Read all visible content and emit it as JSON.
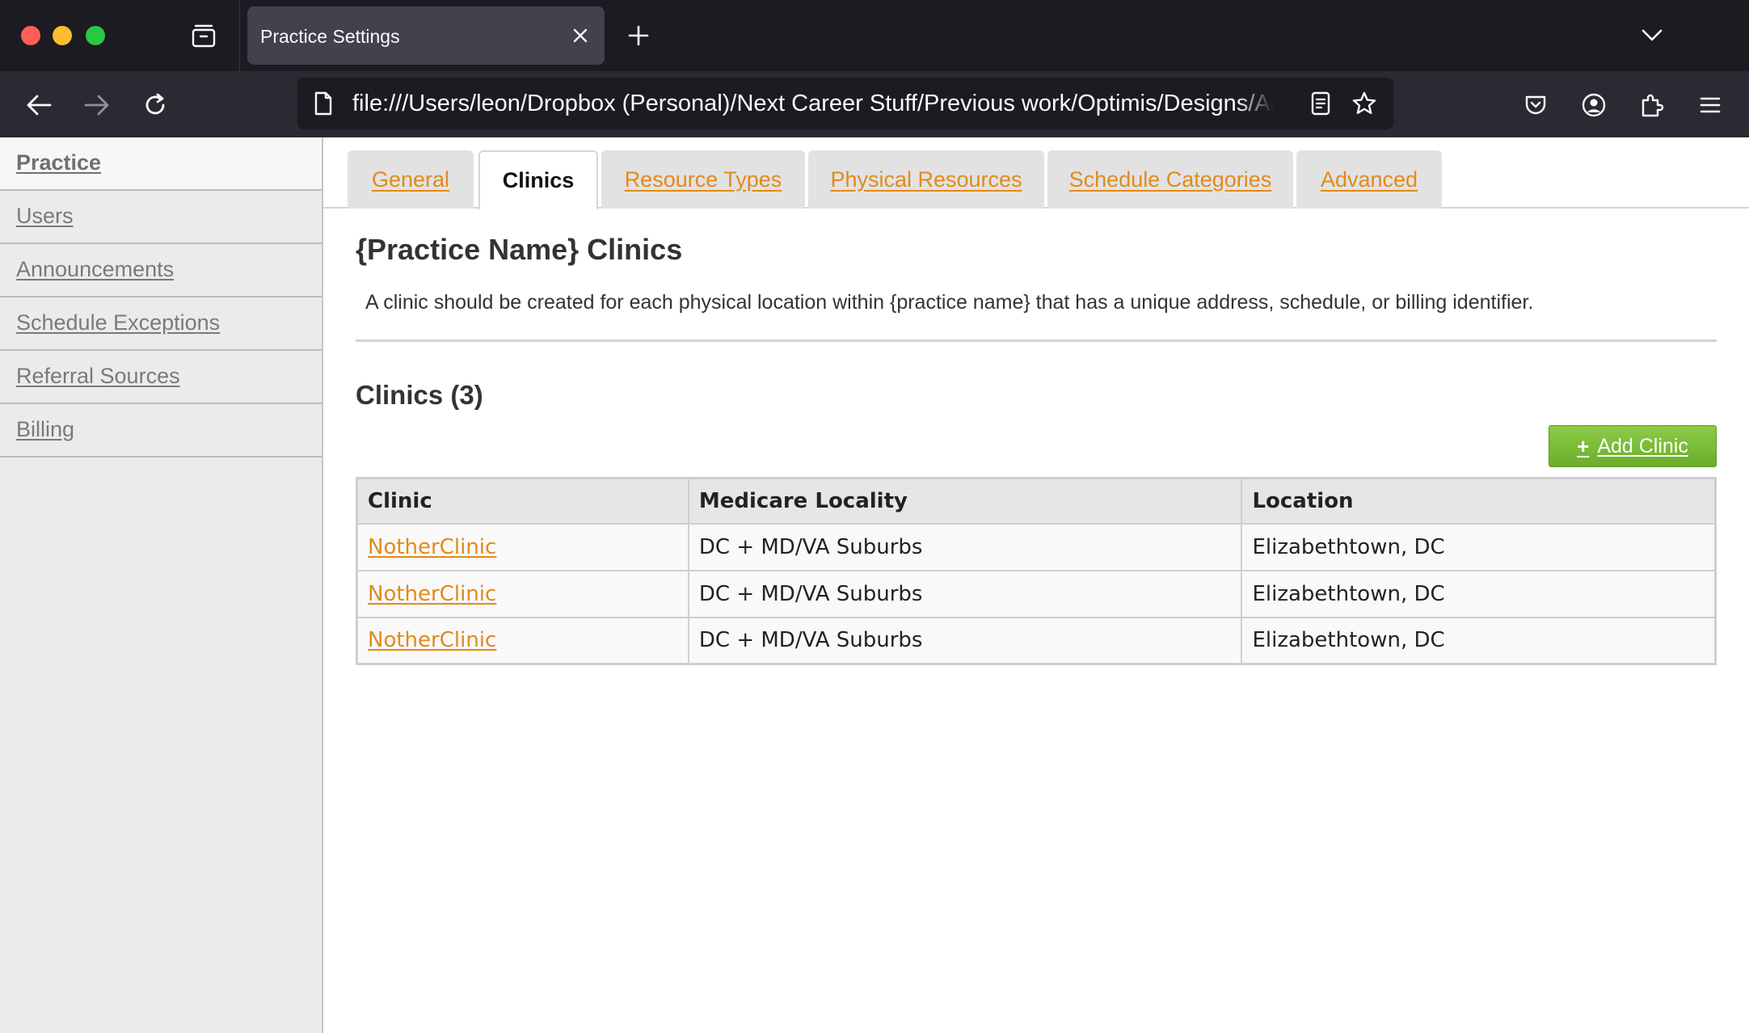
{
  "browser": {
    "tab_title": "Practice Settings",
    "url": "file:///Users/leon/Dropbox (Personal)/Next Career Stuff/Previous work/Optimis/Designs/Admin"
  },
  "sidebar": {
    "items": [
      {
        "label": "Practice"
      },
      {
        "label": "Users"
      },
      {
        "label": "Announcements"
      },
      {
        "label": "Schedule Exceptions"
      },
      {
        "label": "Referral Sources"
      },
      {
        "label": "Billing"
      }
    ]
  },
  "tabs": [
    {
      "label": "General"
    },
    {
      "label": "Clinics"
    },
    {
      "label": "Resource Types"
    },
    {
      "label": "Physical Resources"
    },
    {
      "label": "Schedule Categories"
    },
    {
      "label": "Advanced"
    }
  ],
  "main": {
    "title": "{Practice Name} Clinics",
    "description": "A clinic should be created for each physical location within {practice name} that has a unique address, schedule, or billing identifier.",
    "section_title": "Clinics (3)",
    "add_button": {
      "plus": "+",
      "label": "Add Clinic"
    },
    "table": {
      "headers": [
        "Clinic",
        "Medicare Locality",
        "Location"
      ],
      "rows": [
        {
          "clinic": "NotherClinic",
          "locality": "DC + MD/VA Suburbs",
          "location": "Elizabethtown, DC"
        },
        {
          "clinic": "NotherClinic",
          "locality": "DC + MD/VA Suburbs",
          "location": "Elizabethtown, DC"
        },
        {
          "clinic": "NotherClinic",
          "locality": "DC + MD/VA Suburbs",
          "location": "Elizabethtown, DC"
        }
      ]
    }
  },
  "colors": {
    "link_orange": "#e28a1a",
    "add_button_green": "#7bbd37",
    "chrome_dark": "#1c1b22"
  }
}
